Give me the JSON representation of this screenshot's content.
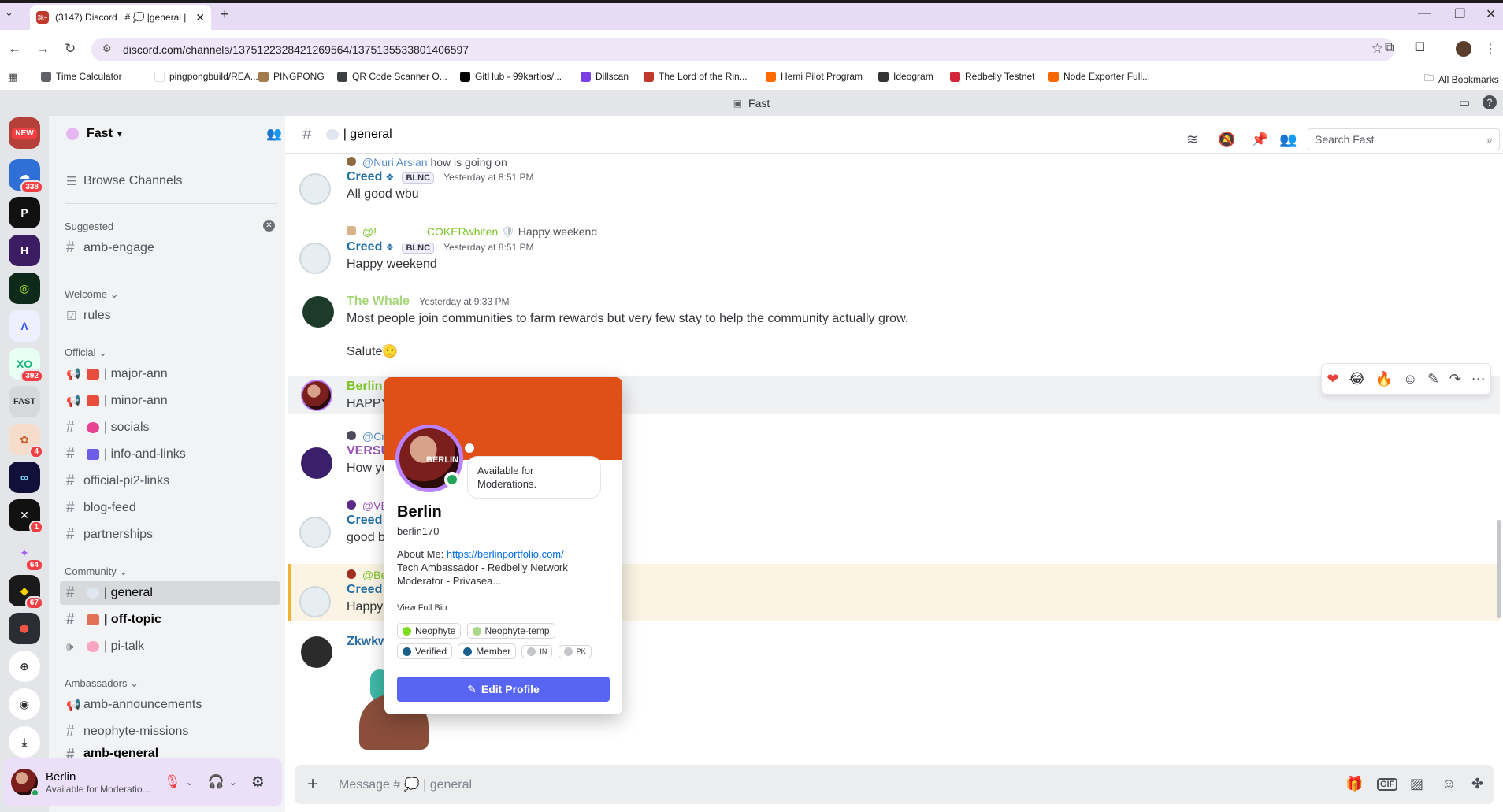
{
  "browser": {
    "tab_title": "(3147) Discord | # 💭 |general |",
    "tab_favicon_text": "3k+",
    "url": "discord.com/channels/1375122328421269564/1375135533801406597",
    "bookmarks": [
      {
        "label": "Time Calculator",
        "color": "#5f6368"
      },
      {
        "label": "pingpongbuild/REA...",
        "color": "#ffffff"
      },
      {
        "label": "PINGPONG",
        "color": "#a57b4d"
      },
      {
        "label": "QR Code Scanner O...",
        "color": "#3c4043"
      },
      {
        "label": "GitHub - 99kartlos/...",
        "color": "#000000"
      },
      {
        "label": "Dillscan",
        "color": "#7b3fe4"
      },
      {
        "label": "The Lord of the Rin...",
        "color": "#c0392b"
      },
      {
        "label": "Hemi Pilot Program",
        "color": "#ff6b00"
      },
      {
        "label": "Ideogram",
        "color": "#333333"
      },
      {
        "label": "Redbelly Testnet",
        "color": "#d3263a"
      },
      {
        "label": "Node Exporter Full...",
        "color": "#f46800"
      }
    ],
    "all_bookmarks": "All Bookmarks"
  },
  "discord": {
    "window_title": "Fast",
    "server_name": "Fast",
    "guild_badges": [
      "NEW",
      "338",
      "392",
      "FAST",
      "4",
      "1",
      "64",
      "67"
    ],
    "browse_channels": "Browse Channels",
    "suggested_label": "Suggested",
    "categories": {
      "welcome": "Welcome",
      "official": "Official",
      "community": "Community",
      "ambassadors": "Ambassadors"
    },
    "channels": {
      "amb_engage": "amb-engage",
      "rules": "rules",
      "major_ann": "| major-ann",
      "minor_ann": "| minor-ann",
      "socials": "| socials",
      "info_links": "| info-and-links",
      "official_pi2": "official-pi2-links",
      "blog_feed": "blog-feed",
      "partnerships": "partnerships",
      "general": "| general",
      "off_topic": "| off-topic",
      "pi_talk": "| pi-talk",
      "amb_announcements": "amb-announcements",
      "neophyte_missions": "neophyte-missions",
      "amb_general": "amb-general"
    },
    "current_channel": "| general",
    "search_placeholder": "Search Fast",
    "user": {
      "name": "Berlin",
      "status": "Available for Moderatio..."
    },
    "composer_placeholder": "Message # 💭 | general",
    "messages": [
      {
        "reply_name": "@Nuri Arslan",
        "reply_text": "how is going  on",
        "author": "Creed",
        "author_color": "#1f6fa6",
        "tag": "BLNC",
        "time": "Yesterday at 8:51 PM",
        "text": "All good wbu"
      },
      {
        "reply_name": "@!",
        "reply_name2": "COKERwhiten",
        "reply_text": "Happy weekend",
        "author": "Creed",
        "author_color": "#1f6fa6",
        "tag": "BLNC",
        "time": "Yesterday at 8:51 PM",
        "text": "Happy weekend"
      },
      {
        "author": "The Whale",
        "author_color": "#a5d67a",
        "time": "Yesterday at 9:33 PM",
        "text": "Most people join communities to farm rewards but very few stay to help the community actually grow.",
        "text2": "Salute🫡"
      },
      {
        "author": "Berlin",
        "author_color": "#7cc425",
        "text": "HAPPY"
      },
      {
        "reply_name": "@Cr",
        "author": "VERSU",
        "author_color": "#9b59b6",
        "text": "How yo"
      },
      {
        "reply_name": "@VE",
        "author": "Creed",
        "author_color": "#1f6fa6",
        "text": "good br"
      },
      {
        "reply_name": "@Be",
        "author": "Creed",
        "author_color": "#1f6fa6",
        "text": "Happy"
      },
      {
        "author": "Zkwkw",
        "author_color": "#2b6fa6"
      }
    ],
    "profile": {
      "custom_status": "Available for Moderations.",
      "display_name": "Berlin",
      "username": "berlin170",
      "about_label": "About Me:",
      "about_link": "https://berlinportfolio.com/",
      "bio_line1": "Tech Ambassador - Redbelly Network",
      "bio_line2": "Moderator - Privasea...",
      "view_full_bio": "View Full Bio",
      "roles": [
        {
          "name": "Neophyte",
          "color": "#7cdc1f"
        },
        {
          "name": "Neophyte-temp",
          "color": "#a8d88a"
        },
        {
          "name": "Verified",
          "color": "#1a5f8a"
        },
        {
          "name": "Member",
          "color": "#1a5f8a"
        },
        {
          "name": "IN",
          "color": "#c4c6ca"
        },
        {
          "name": "PK",
          "color": "#c4c6ca"
        }
      ],
      "edit_profile": "Edit Profile",
      "avatar_text": "BERLIN"
    },
    "hover_actions": [
      "❤️",
      "😂",
      "🔥",
      "emoji-add",
      "edit",
      "reply",
      "more"
    ]
  }
}
